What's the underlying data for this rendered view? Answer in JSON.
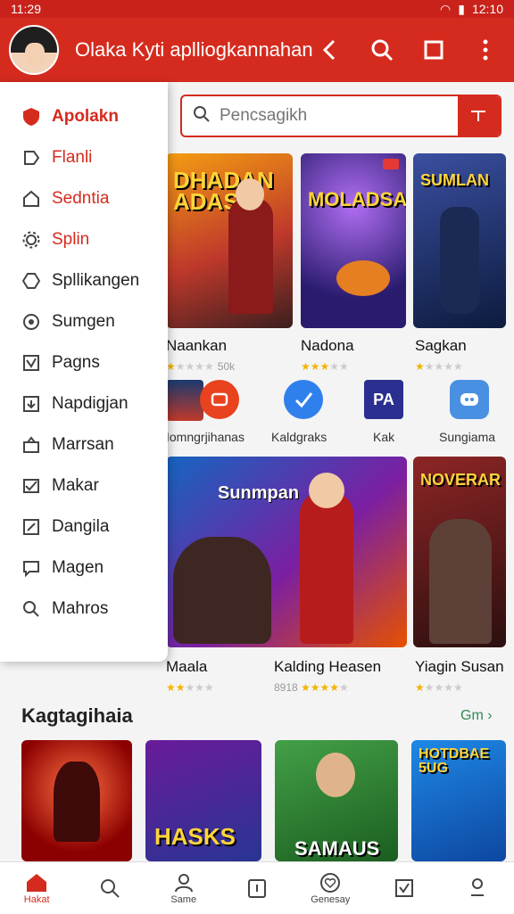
{
  "status_bar": {
    "time_left": "11:29",
    "time_right": "12:10"
  },
  "app_bar": {
    "title": "Olaka Kyti aplliogkannahan"
  },
  "drawer": {
    "items": [
      {
        "label": "Apolakn",
        "icon": "shield-icon"
      },
      {
        "label": "Flanli",
        "icon": "tag-icon"
      },
      {
        "label": "Sedntia",
        "icon": "home-icon"
      },
      {
        "label": "Splin",
        "icon": "gear-icon"
      },
      {
        "label": "Spllikangen",
        "icon": "hexagon-icon"
      },
      {
        "label": "Sumgen",
        "icon": "circle-icon"
      },
      {
        "label": "Pagns",
        "icon": "checkbox-icon"
      },
      {
        "label": "Napdigjan",
        "icon": "download-icon"
      },
      {
        "label": "Marrsan",
        "icon": "bag-icon"
      },
      {
        "label": "Makar",
        "icon": "mail-icon"
      },
      {
        "label": "Dangila",
        "icon": "edit-icon"
      },
      {
        "label": "Magen",
        "icon": "chat-icon"
      },
      {
        "label": "Mahros",
        "icon": "search-icon"
      }
    ]
  },
  "search": {
    "placeholder": "Pencsagikh"
  },
  "featured": [
    {
      "label": "Naankan",
      "cover": "DHADAN ADAS",
      "rating": "50k"
    },
    {
      "label": "Nadona",
      "cover": "MOLADSA",
      "rating": ""
    },
    {
      "label": "Sagkan",
      "cover": "SUMLAN",
      "rating": ""
    }
  ],
  "apps_row": [
    {
      "label": "Iomngrjihanas"
    },
    {
      "label": "Kaldgraks"
    },
    {
      "label": "Kak",
      "icon_text": "PA"
    },
    {
      "label": "Sungiama"
    }
  ],
  "big_cards": [
    {
      "label": "Maala",
      "cover": "Sunmpan"
    },
    {
      "label": "Kalding Heasen",
      "cover": "",
      "meta": "8918"
    },
    {
      "label": "Yiagin Susan",
      "cover": "NOVERAR"
    }
  ],
  "section": {
    "title": "Kagtagihaia",
    "see_more": "Gm"
  },
  "bottom_cards": [
    {
      "cover": ""
    },
    {
      "cover": "HASKS"
    },
    {
      "cover": "SAMAUS"
    },
    {
      "cover": "HOTDBAE 5UG"
    }
  ],
  "bottom_nav": [
    {
      "label": "Hakat",
      "icon": "home-icon",
      "active": true
    },
    {
      "label": "",
      "icon": "search-icon"
    },
    {
      "label": "Same",
      "icon": "person-icon"
    },
    {
      "label": "",
      "icon": "clipboard-icon"
    },
    {
      "label": "Genesay",
      "icon": "heart-icon"
    },
    {
      "label": "",
      "icon": "checkbox-icon"
    },
    {
      "label": "",
      "icon": "profile-icon"
    }
  ],
  "colors": {
    "brand": "#d52b1e",
    "accent_green": "#2e8b57",
    "star": "#f4b400"
  }
}
